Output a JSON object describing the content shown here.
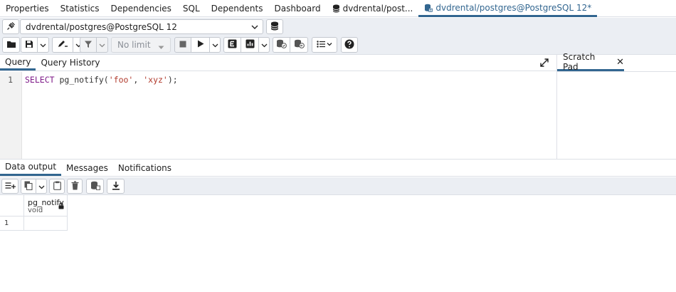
{
  "tabs": [
    {
      "label": "Properties",
      "active": false
    },
    {
      "label": "Statistics",
      "active": false
    },
    {
      "label": "Dependencies",
      "active": false
    },
    {
      "label": "SQL",
      "active": false
    },
    {
      "label": "Dependents",
      "active": false
    },
    {
      "label": "Dashboard",
      "active": false
    },
    {
      "label": "dvdrental/post...",
      "active": false,
      "icon": "database-icon"
    },
    {
      "label": "dvdrental/postgres@PostgreSQL 12*",
      "active": true,
      "icon": "query-tool-icon"
    }
  ],
  "connection": {
    "selected": "dvdrental/postgres@PostgreSQL 12"
  },
  "toolbar": {
    "limit_placeholder": "No limit"
  },
  "query_tabs": [
    {
      "label": "Query",
      "active": true
    },
    {
      "label": "Query History",
      "active": false
    }
  ],
  "editor": {
    "line_number": "1",
    "tokens": {
      "keyword": "SELECT",
      "function": "pg_notify(",
      "arg1": "'foo'",
      "sep": ", ",
      "arg2": "'xyz'",
      "end": ");"
    }
  },
  "scratch_pad": {
    "label": "Scratch Pad",
    "close": "✕"
  },
  "output_tabs": [
    {
      "label": "Data output",
      "active": true
    },
    {
      "label": "Messages",
      "active": false
    },
    {
      "label": "Notifications",
      "active": false
    }
  ],
  "result": {
    "columns": [
      {
        "name": "pg_notify",
        "type": "void"
      }
    ],
    "rows": [
      {
        "row_number": "1",
        "values": [
          ""
        ]
      }
    ]
  },
  "colors": {
    "accent": "#326690",
    "toolbar_bg": "#ebeef3"
  }
}
